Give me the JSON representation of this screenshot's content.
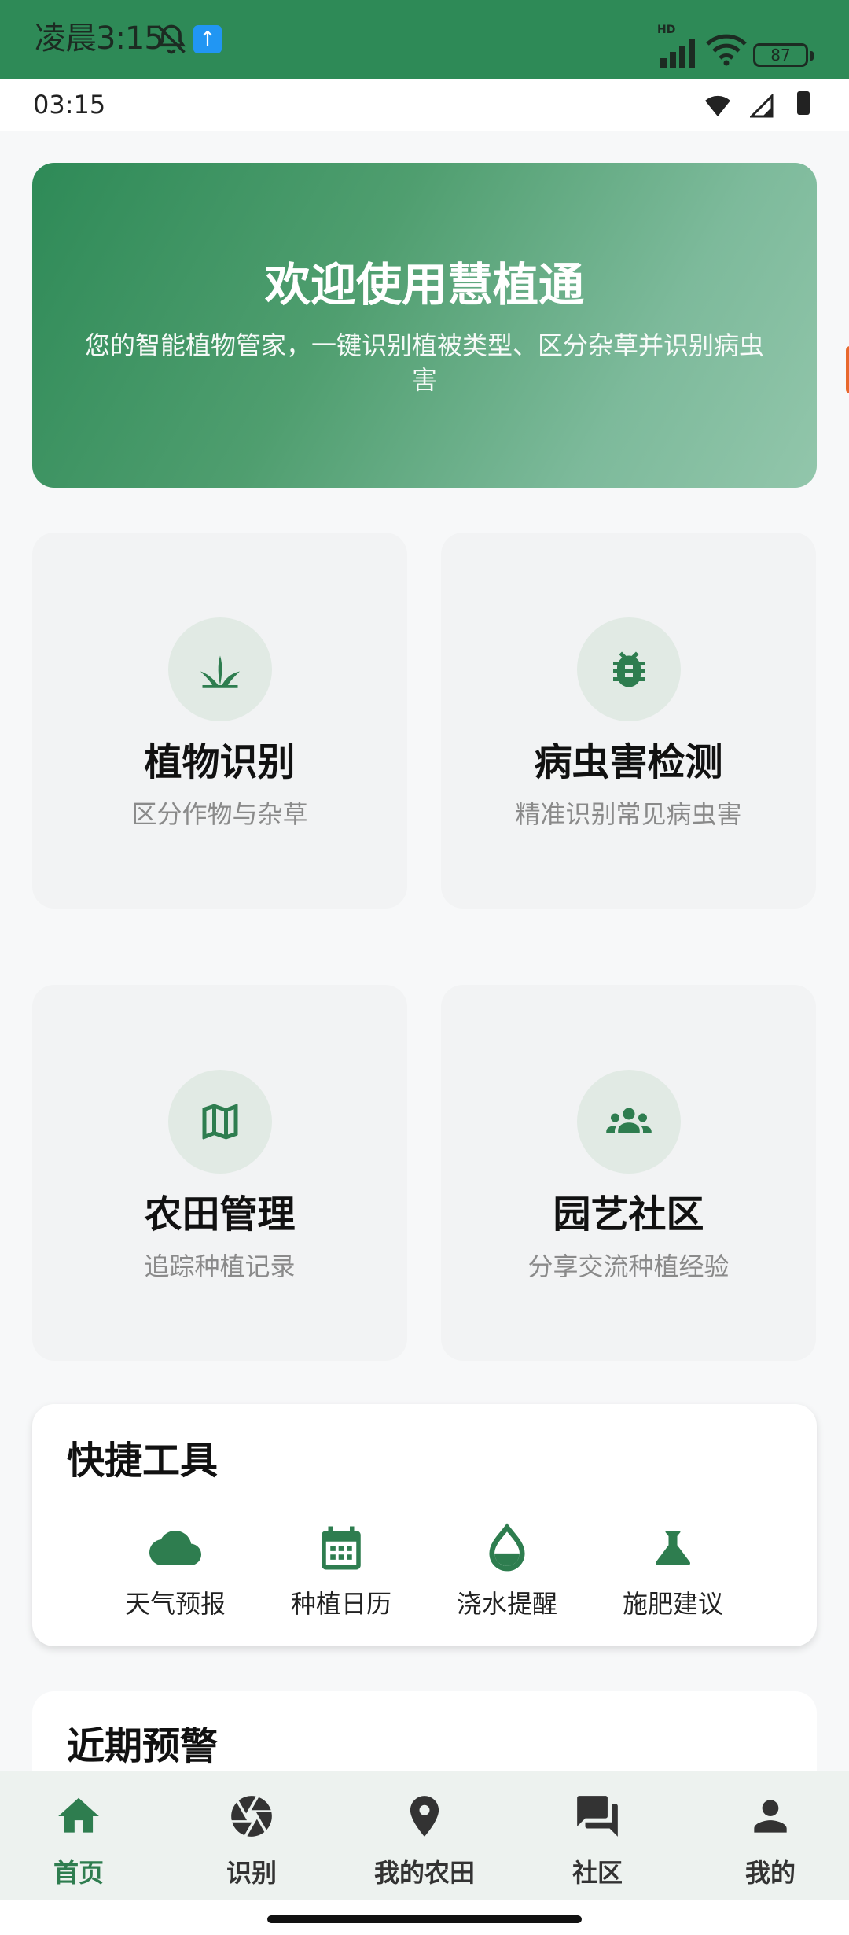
{
  "system_status": {
    "time": "凌晨3:15",
    "battery": "87",
    "network_badge": "HD"
  },
  "app_status": {
    "time": "03:15"
  },
  "hero": {
    "title": "欢迎使用慧植通",
    "subtitle": "您的智能植物管家，一键识别植被类型、区分杂草并识别病虫害"
  },
  "features": [
    {
      "title": "植物识别",
      "subtitle": "区分作物与杂草",
      "icon": "grass-icon"
    },
    {
      "title": "病虫害检测",
      "subtitle": "精准识别常见病虫害",
      "icon": "bug-icon"
    },
    {
      "title": "农田管理",
      "subtitle": "追踪种植记录",
      "icon": "map-icon"
    },
    {
      "title": "园艺社区",
      "subtitle": "分享交流种植经验",
      "icon": "groups-icon"
    }
  ],
  "quick_tools": {
    "title": "快捷工具",
    "items": [
      {
        "label": "天气预报",
        "icon": "cloud-icon"
      },
      {
        "label": "种植日历",
        "icon": "calendar-icon"
      },
      {
        "label": "浇水提醒",
        "icon": "water-drop-icon"
      },
      {
        "label": "施肥建议",
        "icon": "flask-icon"
      }
    ]
  },
  "alerts": {
    "title": "近期预警"
  },
  "bottom_nav": [
    {
      "label": "首页",
      "icon": "home-icon",
      "active": true
    },
    {
      "label": "识别",
      "icon": "camera-aperture-icon",
      "active": false
    },
    {
      "label": "我的农田",
      "icon": "location-pin-icon",
      "active": false
    },
    {
      "label": "社区",
      "icon": "chat-forum-icon",
      "active": false
    },
    {
      "label": "我的",
      "icon": "person-icon",
      "active": false
    }
  ],
  "colors": {
    "primary": "#2e8a57",
    "icon_green": "#2e7d4f",
    "card_bg": "#f2f3f4",
    "icon_circle": "#e1eae4",
    "nav_bg": "#edf2ef"
  }
}
